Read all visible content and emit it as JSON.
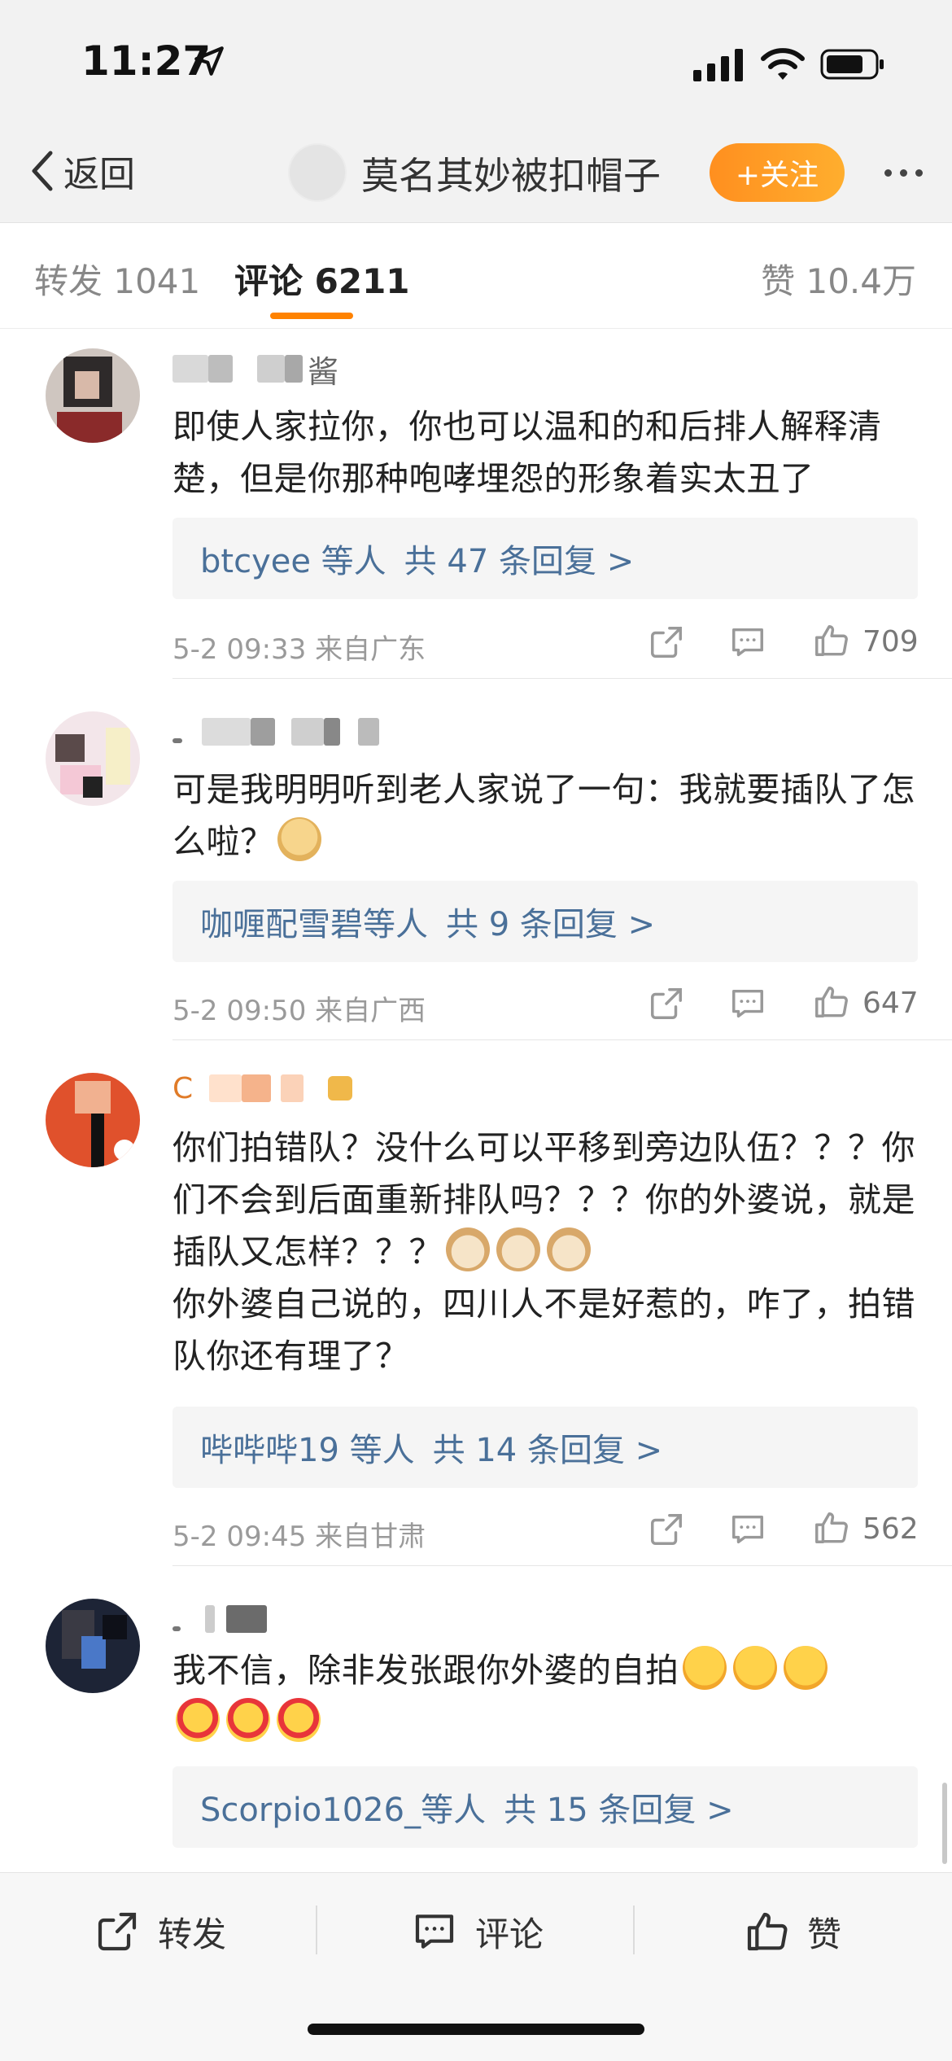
{
  "status_bar": {
    "time": "11:27"
  },
  "nav": {
    "back_label": "返回",
    "title": "莫名其妙被扣帽子",
    "follow_label": "+关注"
  },
  "tabs": {
    "repost": "转发 1041",
    "comments": "评论 6211",
    "likes": "赞 10.4万"
  },
  "comments": [
    {
      "username_suffix": "酱",
      "text": "即使人家拉你，你也可以温和的和后排人解释清楚，但是你那种咆哮埋怨的形象着实太丑了",
      "reply_users": "btcyee 等人",
      "reply_count": "共 47 条回复 >",
      "meta": "5-2 09:33 来自广东",
      "likes": "709"
    },
    {
      "text": "可是我明明听到老人家说了一句：我就要插队了怎么啦？",
      "emojis": [
        "doge"
      ],
      "reply_users": "咖喱配雪碧等人",
      "reply_count": "共 9 条回复 >",
      "meta": "5-2 09:50 来自广西",
      "likes": "647"
    },
    {
      "text_1": "你们拍错队？没什么可以平移到旁边队伍？？？你们不会到后面重新排队吗？？？你的外婆说，就是插队又怎样？？？",
      "text_2": "你外婆自己说的，四川人不是好惹的，咋了，拍错队你还有理了？",
      "emojis": [
        "cat",
        "cat",
        "cat"
      ],
      "reply_users": "哔哔哔19 等人",
      "reply_count": "共 14 条回复 >",
      "meta": "5-2 09:45 来自甘肃",
      "likes": "562"
    },
    {
      "text": "我不信，除非发张跟你外婆的自拍",
      "emojis": [
        "pleading",
        "pleading",
        "pleading",
        "heart-eyes",
        "heart-eyes",
        "heart-eyes"
      ],
      "reply_users": "Scorpio1026_等人",
      "reply_count": "共 15 条回复 >"
    }
  ],
  "bottom_bar": {
    "repost": "转发",
    "comment": "评论",
    "like": "赞"
  },
  "colors": {
    "accent": "#ff8200",
    "link": "#4a7099",
    "follow_gradient_start": "#ff8f1f",
    "follow_gradient_end": "#ffae2e"
  },
  "icons": [
    "location-arrow-icon",
    "signal-icon",
    "wifi-icon",
    "battery-icon",
    "back-chevron-icon",
    "more-dots-icon",
    "share-icon",
    "comment-icon",
    "like-icon"
  ]
}
